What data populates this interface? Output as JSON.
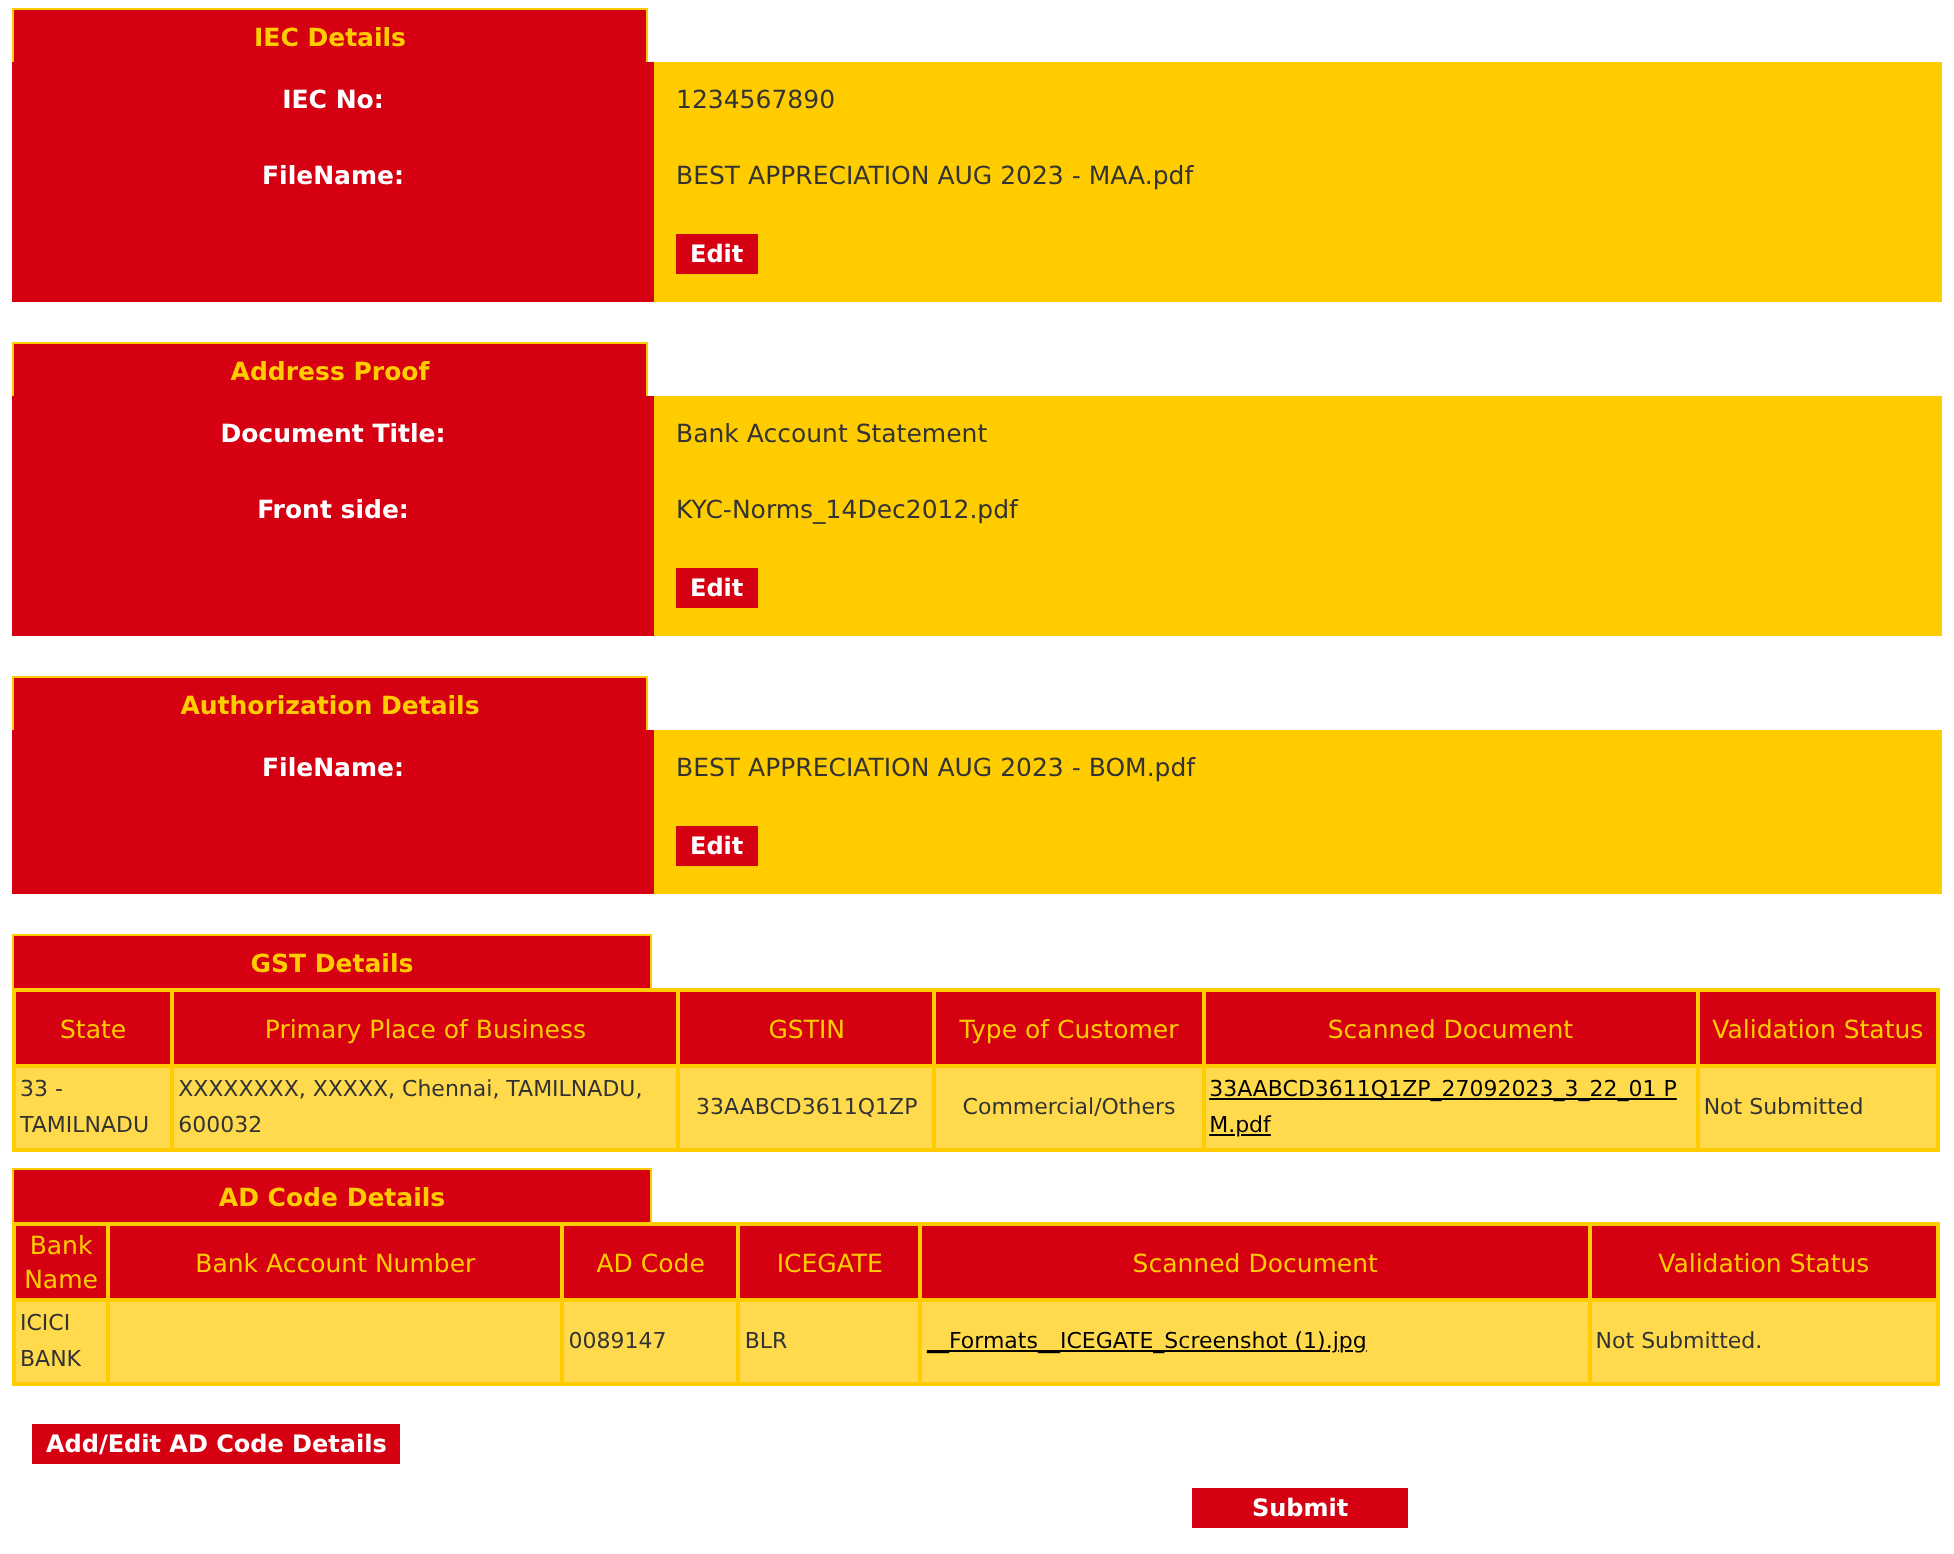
{
  "sections": [
    {
      "kind": "detail",
      "title": "IEC Details",
      "rows": [
        {
          "label": "IEC No:",
          "value": "1234567890"
        },
        {
          "label": "FileName:",
          "value": "BEST APPRECIATION AUG 2023 - MAA.pdf"
        }
      ],
      "button": "Edit"
    },
    {
      "kind": "detail",
      "title": "Address Proof",
      "rows": [
        {
          "label": "Document Title:",
          "value": "Bank Account Statement"
        },
        {
          "label": "Front side:",
          "value": "KYC-Norms_14Dec2012.pdf"
        }
      ],
      "button": "Edit"
    },
    {
      "kind": "detail",
      "title": "Authorization Details",
      "rows": [
        {
          "label": "FileName:",
          "value": "BEST APPRECIATION AUG 2023 - BOM.pdf"
        }
      ],
      "button": "Edit"
    },
    {
      "kind": "table",
      "title": "GST Details",
      "columns": [
        "State",
        "Primary Place of Business",
        "GSTIN",
        "Type of Customer",
        "Scanned Document",
        "Validation Status"
      ],
      "rows": [
        [
          {
            "text": "33 - TAMILNADU",
            "link": false
          },
          {
            "text": "XXXXXXXX, XXXXX, Chennai, TAMILNADU, 600032",
            "link": false
          },
          {
            "text": "33AABCD3611Q1ZP",
            "link": false
          },
          {
            "text": "Commercial/Others",
            "link": false
          },
          {
            "text": "33AABCD3611Q1ZP_27092023_3_22_01 PM.pdf",
            "link": true
          },
          {
            "text": "Not Submitted",
            "link": false
          }
        ]
      ]
    },
    {
      "kind": "table",
      "title": "AD Code Details",
      "columns": [
        "Bank Name",
        "Bank Account Number",
        "AD Code",
        "ICEGATE",
        "Scanned Document",
        "Validation Status"
      ],
      "rows": [
        [
          {
            "text": "ICICI BANK",
            "link": false
          },
          {
            "link": false
          },
          {
            "text": "0089147",
            "link": false
          },
          {
            "text": "BLR",
            "link": false
          },
          {
            "text": "__Formats__ICEGATE_Screenshot (1).jpg",
            "link": true
          },
          {
            "text": "Not Submitted.",
            "link": false
          }
        ]
      ]
    }
  ],
  "add_button": "Add/Edit AD Code Details",
  "submit_button": "Submit"
}
